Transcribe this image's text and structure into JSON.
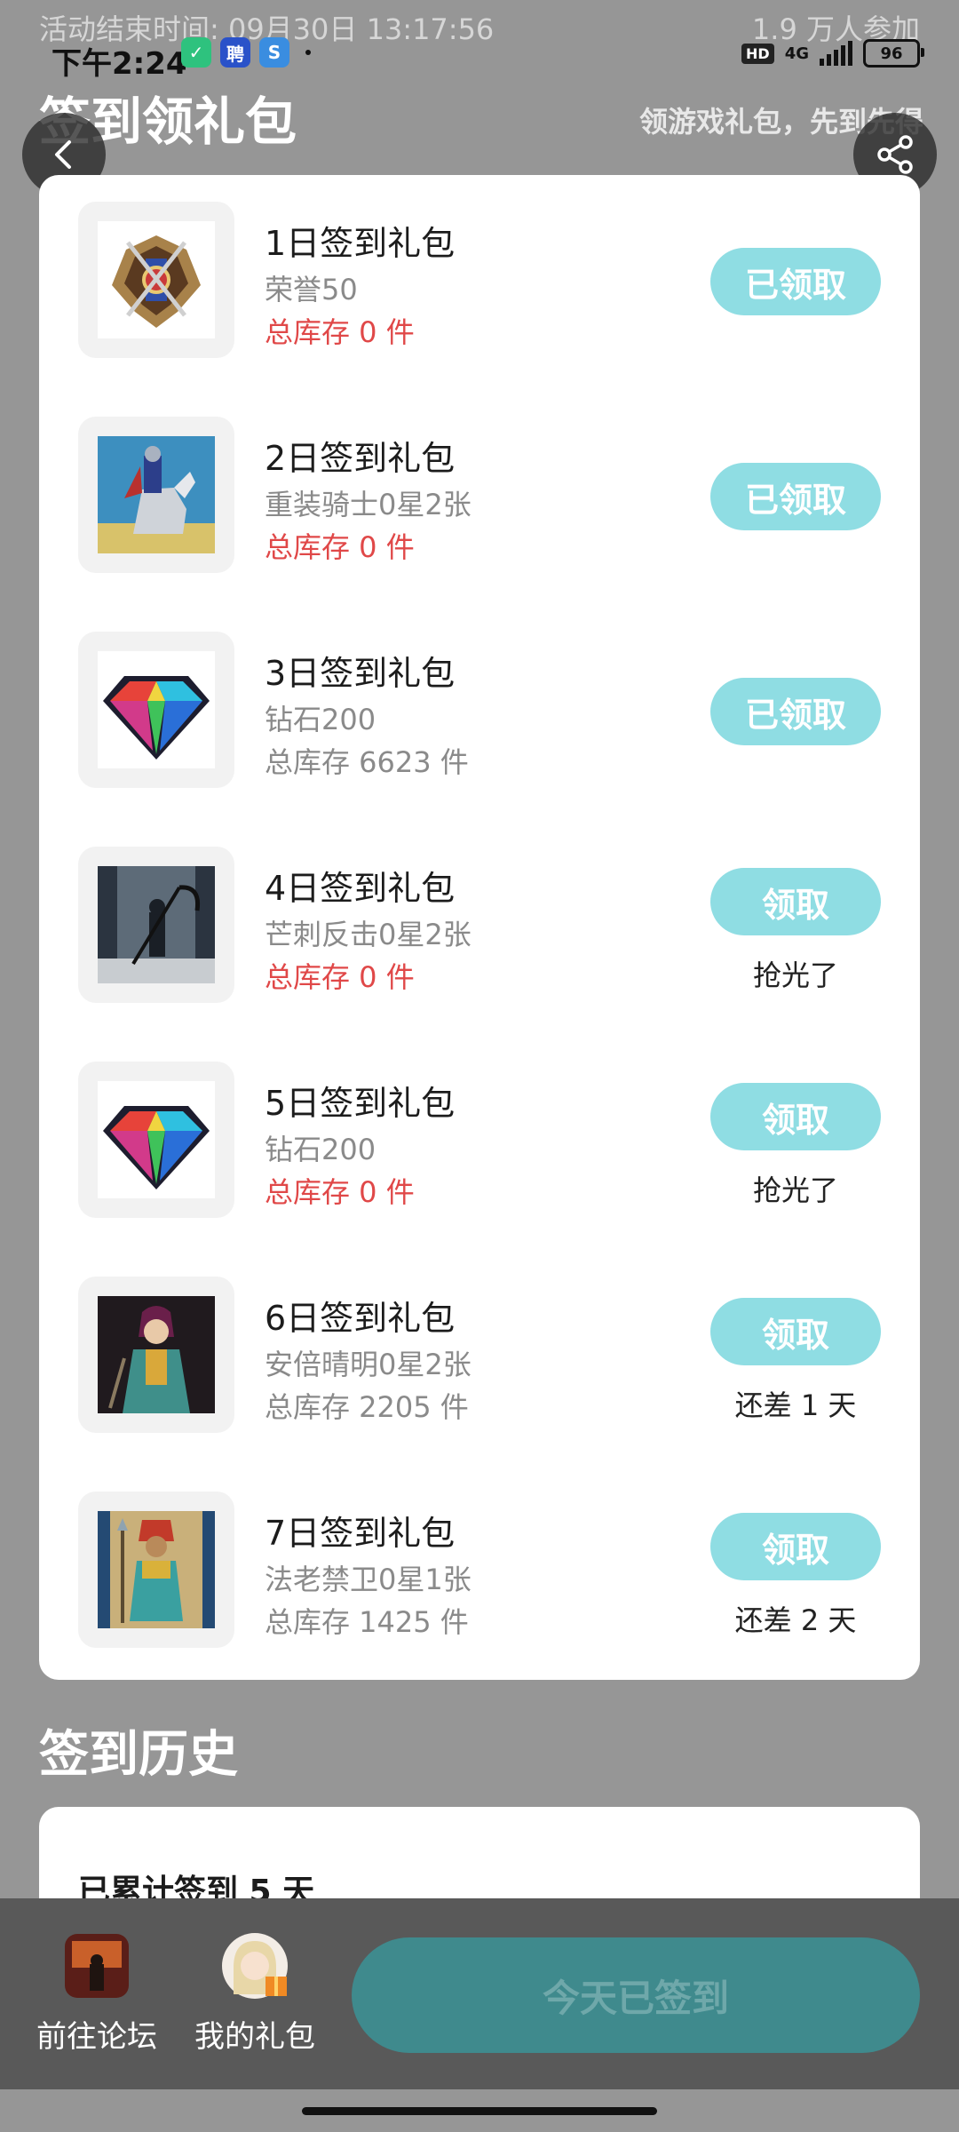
{
  "status_bar": {
    "activity_end_time": "活动结束时间: 09月30日 13:17:56",
    "participants": "1.9 万人参加",
    "time": "下午2:24",
    "network": "4G",
    "battery": "96",
    "hd": "HD"
  },
  "header": {
    "title": "签到领礼包",
    "subtitle": "领游戏礼包，先到先得"
  },
  "gifts": [
    {
      "name": "1日签到礼包",
      "desc": "荣誉50",
      "stock": "总库存 0 件",
      "stock_empty": true,
      "button": "已领取",
      "note": "",
      "icon": "emblem-icon"
    },
    {
      "name": "2日签到礼包",
      "desc": "重装骑士0星2张",
      "stock": "总库存 0 件",
      "stock_empty": true,
      "button": "已领取",
      "note": "",
      "icon": "knight-icon"
    },
    {
      "name": "3日签到礼包",
      "desc": "钻石200",
      "stock": "总库存 6623 件",
      "stock_empty": false,
      "button": "已领取",
      "note": "",
      "icon": "diamond-icon"
    },
    {
      "name": "4日签到礼包",
      "desc": "芒刺反击0星2张",
      "stock": "总库存 0 件",
      "stock_empty": true,
      "button": "领取",
      "note": "抢光了",
      "icon": "scythe-warrior-icon"
    },
    {
      "name": "5日签到礼包",
      "desc": "钻石200",
      "stock": "总库存 0 件",
      "stock_empty": true,
      "button": "领取",
      "note": "抢光了",
      "icon": "diamond-icon"
    },
    {
      "name": "6日签到礼包",
      "desc": "安倍晴明0星2张",
      "stock": "总库存 2205 件",
      "stock_empty": false,
      "button": "领取",
      "note": "还差 1 天",
      "icon": "onmyoji-icon"
    },
    {
      "name": "7日签到礼包",
      "desc": "法老禁卫0星1张",
      "stock": "总库存 1425 件",
      "stock_empty": false,
      "button": "领取",
      "note": "还差 2 天",
      "icon": "pharaoh-guard-icon"
    }
  ],
  "history": {
    "title": "签到历史",
    "summary": "已累计签到 5 天"
  },
  "bottom_bar": {
    "forum_label": "前往论坛",
    "my_gifts_label": "我的礼包",
    "signed_label": "今天已签到"
  },
  "colors": {
    "claim_button": "#8fdde3",
    "stock_out": "#e04848",
    "signed_button": "#3f8a8d"
  }
}
